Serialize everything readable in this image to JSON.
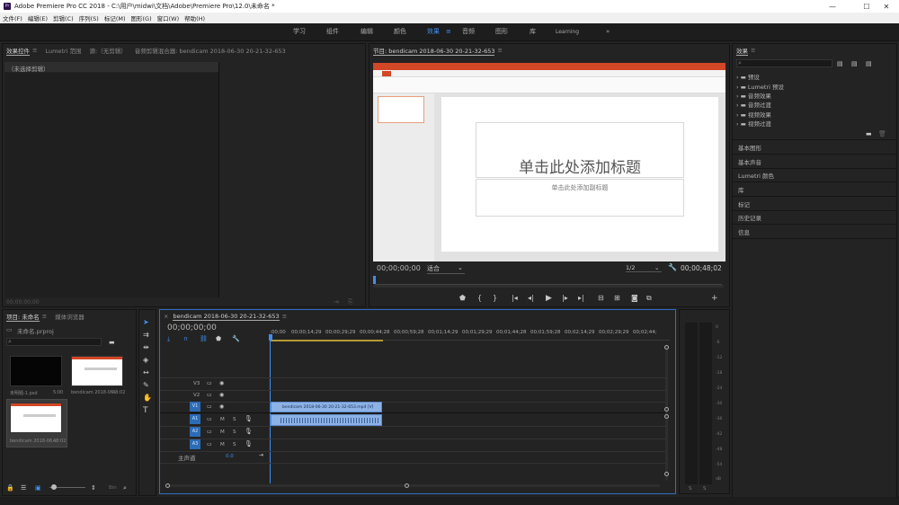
{
  "window": {
    "title": "Adobe Premiere Pro CC 2018 - C:\\用户\\midwi\\文档\\Adobe\\Premiere Pro\\12.0\\未命名 *",
    "app_badge": "Pr",
    "minimize": "—",
    "maximize": "☐",
    "close": "✕"
  },
  "menu": [
    "文件(F)",
    "编辑(E)",
    "剪辑(C)",
    "序列(S)",
    "标记(M)",
    "图形(G)",
    "窗口(W)",
    "帮助(H)"
  ],
  "workspaces": {
    "items": [
      "学习",
      "组件",
      "编辑",
      "颜色",
      "效果",
      "音频",
      "图形",
      "库",
      "Learning"
    ],
    "active_index": 4,
    "menu_glyph": "≡",
    "more": "»"
  },
  "source_panel": {
    "tabs": [
      "效果控件",
      "Lumetri 范围",
      "源:（无剪辑）",
      "音频剪辑混合器: bendicam 2018-06-30 20-21-32-653"
    ],
    "menu_glyph": "≡",
    "no_clip_text": "（未选择剪辑）",
    "timecode": "00;00;00;00"
  },
  "program_panel": {
    "title": "节目: bendicam 2018-06-30 20-21-32-653",
    "menu_glyph": "≡",
    "slide_title": "单击此处添加标题",
    "slide_subtitle": "单击此处添加副标题",
    "timecode_left": "00;00;00;00",
    "fit_label": "适合",
    "resolution": "1/2",
    "timecode_right": "00;00;48;02"
  },
  "effects_panel": {
    "title": "效果",
    "menu_glyph": "≡",
    "tree": [
      "预设",
      "Lumetri 预设",
      "音频效果",
      "音频过渡",
      "视频效果",
      "视频过渡"
    ],
    "sections": [
      "基本图形",
      "基本声音",
      "Lumetri 颜色",
      "库",
      "标记",
      "历史记录",
      "信息"
    ]
  },
  "project_panel": {
    "tabs": [
      "项目: 未命名",
      "媒体浏览器"
    ],
    "menu_glyph": "≡",
    "project_file": "未命名.prproj",
    "items": [
      {
        "name": "未明题-1.psd",
        "duration": "5:00"
      },
      {
        "name": "bendicam 2018-06...",
        "duration": "48:02"
      },
      {
        "name": "bendicam 2018-06...",
        "duration": "48:02"
      }
    ],
    "bin_label": "Bin"
  },
  "timeline": {
    "title": "bendicam 2018-06-30 20-21-32-653",
    "menu_glyph": "≡",
    "close": "×",
    "timecode": "00;00;00;00",
    "ruler": [
      ":00;00",
      "00;00;14;29",
      "00;00;29;29",
      "00;00;44;28",
      "00;00;59;28",
      "00;01;14;29",
      "00;01;29;29",
      "00;01;44;28",
      "00;01;59;28",
      "00;02;14;29",
      "00;02;29;29",
      "00;02;44;"
    ],
    "video_tracks": [
      "V3",
      "V2",
      "V1"
    ],
    "audio_tracks": [
      "A1",
      "A2",
      "A3"
    ],
    "mute_label": "M",
    "solo_label": "S",
    "video_clip_name": "bendicam 2018-06-30 20-21-32-653.mp4 [V]",
    "master_label": "主声道",
    "master_value": "0.0"
  },
  "meter": {
    "labels": [
      "0",
      "-6",
      "-12",
      "-18",
      "-24",
      "-30",
      "-36",
      "-42",
      "-48",
      "-54",
      "dB"
    ],
    "solo_buttons": [
      "S",
      "S"
    ]
  },
  "tools": [
    "selection",
    "track-select",
    "ripple-edit",
    "razor",
    "slip",
    "pen",
    "hand",
    "type"
  ],
  "colors": {
    "accent": "#3f8ff0",
    "clip": "#8cb2e6",
    "target": "#2b6cb5",
    "ppt_orange": "#d24726"
  }
}
